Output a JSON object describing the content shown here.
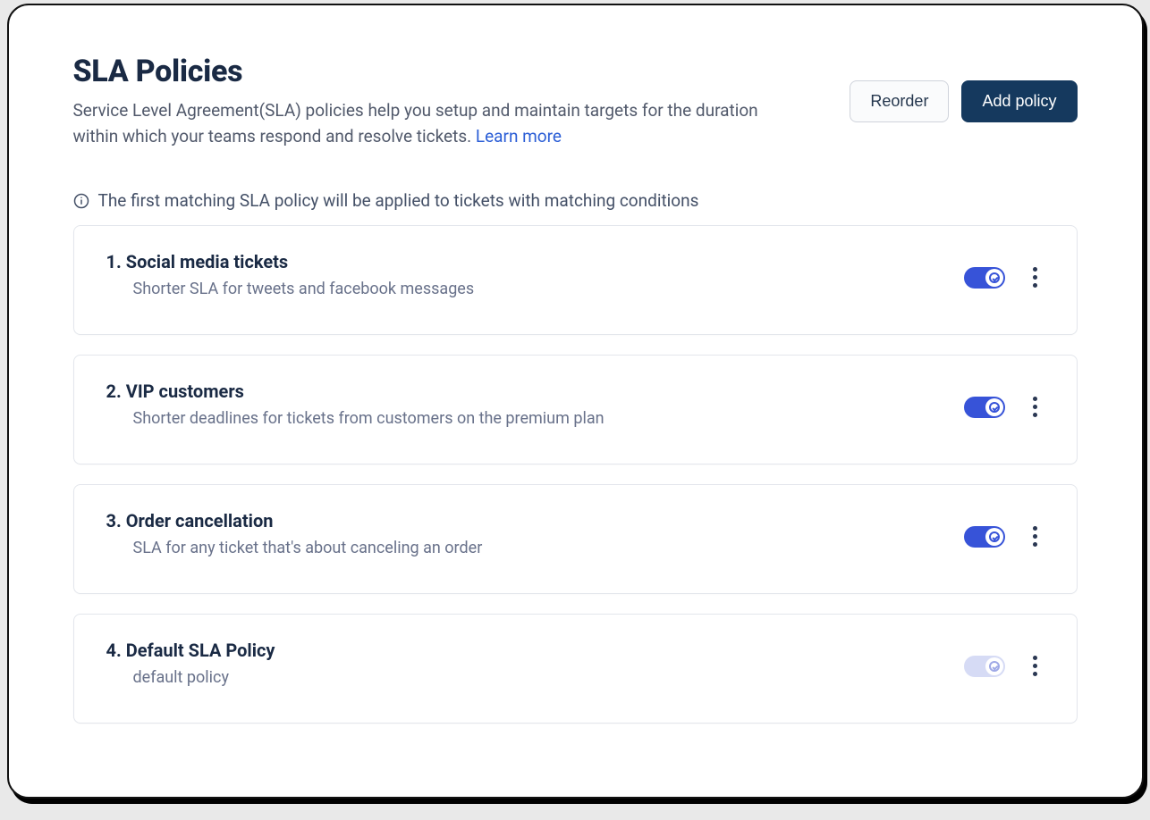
{
  "header": {
    "title": "SLA Policies",
    "subtitle_a": "Service Level Agreement(SLA) policies help you setup and maintain targets for the duration within which your teams respond and resolve tickets. ",
    "learn_more": "Learn more"
  },
  "actions": {
    "reorder": "Reorder",
    "add_policy": "Add policy"
  },
  "note": "The first matching SLA policy will be applied to tickets with matching conditions",
  "policies": [
    {
      "num": "1.",
      "title": "Social media tickets",
      "desc": "Shorter SLA for tweets and facebook messages",
      "enabled": true
    },
    {
      "num": "2.",
      "title": "VIP customers",
      "desc": "Shorter deadlines for tickets from customers on the premium plan",
      "enabled": true
    },
    {
      "num": "3.",
      "title": "Order cancellation",
      "desc": "SLA for any ticket that's about canceling an order",
      "enabled": true
    },
    {
      "num": "4.",
      "title": "Default SLA Policy",
      "desc": "default policy",
      "enabled": false
    }
  ]
}
